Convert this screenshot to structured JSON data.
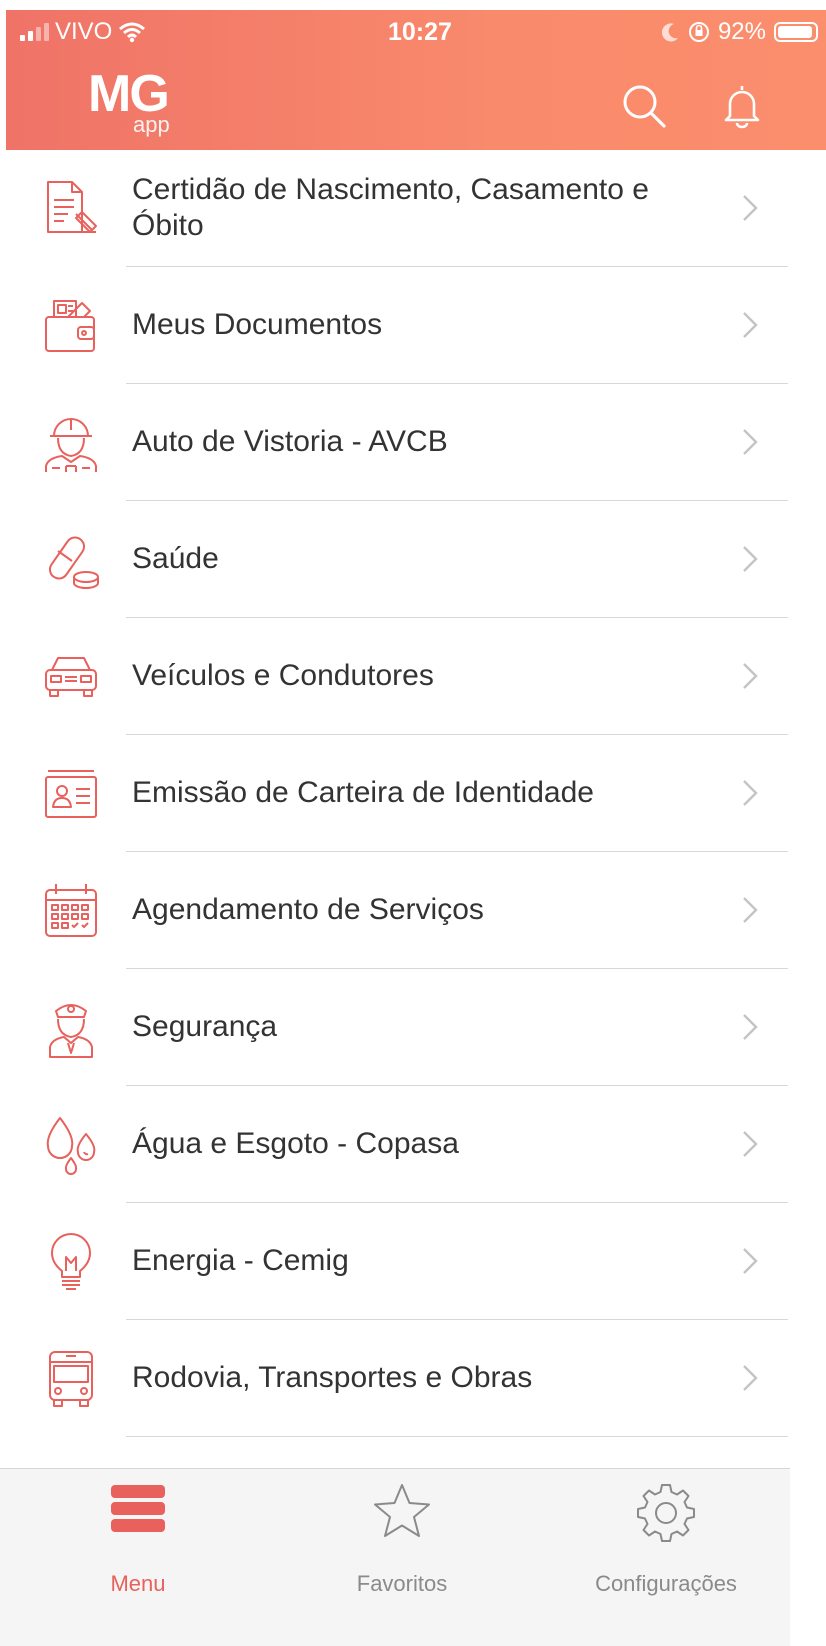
{
  "status_bar": {
    "carrier": "VIVO",
    "time": "10:27",
    "battery": "92%"
  },
  "header": {
    "logo_main": "MG",
    "logo_sub": "app",
    "search_icon": "search-icon",
    "notifications_icon": "bell-icon"
  },
  "menu_items": [
    {
      "label": "Certidão de Nascimento, Casamento e Óbito",
      "icon": "certificate-document-icon"
    },
    {
      "label": "Meus Documentos",
      "icon": "wallet-documents-icon"
    },
    {
      "label": "Auto de Vistoria - AVCB",
      "icon": "firefighter-icon"
    },
    {
      "label": "Saúde",
      "icon": "pill-icon"
    },
    {
      "label": "Veículos e Condutores",
      "icon": "car-icon"
    },
    {
      "label": "Emissão de Carteira de Identidade",
      "icon": "id-card-icon"
    },
    {
      "label": "Agendamento de Serviços",
      "icon": "calendar-icon"
    },
    {
      "label": "Segurança",
      "icon": "police-officer-icon"
    },
    {
      "label": "Água e Esgoto - Copasa",
      "icon": "water-drops-icon"
    },
    {
      "label": "Energia - Cemig",
      "icon": "light-bulb-icon"
    },
    {
      "label": "Rodovia, Transportes e Obras",
      "icon": "bus-icon"
    }
  ],
  "tab_bar": {
    "menu": "Menu",
    "favorites": "Favoritos",
    "settings": "Configurações"
  },
  "colors": {
    "accent": "#e8615c",
    "header_gradient_start": "#ef7367",
    "header_gradient_end": "#fb8e6d"
  }
}
